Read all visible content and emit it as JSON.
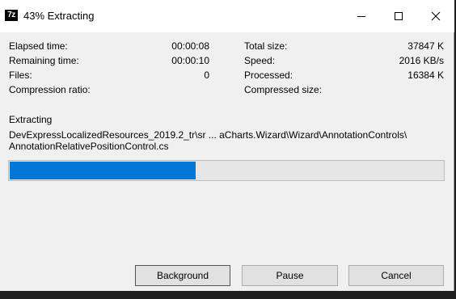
{
  "window": {
    "title": "43% Extracting",
    "icon_label": "7z",
    "icons": {
      "minimize": "minimize-icon",
      "maximize": "maximize-icon",
      "close": "close-icon"
    }
  },
  "stats": {
    "elapsed_time": {
      "label": "Elapsed time:",
      "value": "00:00:08"
    },
    "remaining_time": {
      "label": "Remaining time:",
      "value": "00:00:10"
    },
    "files": {
      "label": "Files:",
      "value": "0"
    },
    "compression_ratio": {
      "label": "Compression ratio:",
      "value": ""
    },
    "total_size": {
      "label": "Total size:",
      "value": "37847 K"
    },
    "speed": {
      "label": "Speed:",
      "value": "2016 KB/s"
    },
    "processed": {
      "label": "Processed:",
      "value": "16384 K"
    },
    "compressed_size": {
      "label": "Compressed size:",
      "value": ""
    }
  },
  "operation": {
    "label": "Extracting",
    "path_line1": "DevExpressLocalizedResources_2019.2_tr\\sr ... aCharts.Wizard\\Wizard\\AnnotationControls\\",
    "path_line2": "AnnotationRelativePositionControl.cs"
  },
  "progress": {
    "fraction": 0.43,
    "color": "#0078d7"
  },
  "buttons": {
    "background": "Background",
    "pause": "Pause",
    "cancel": "Cancel"
  }
}
